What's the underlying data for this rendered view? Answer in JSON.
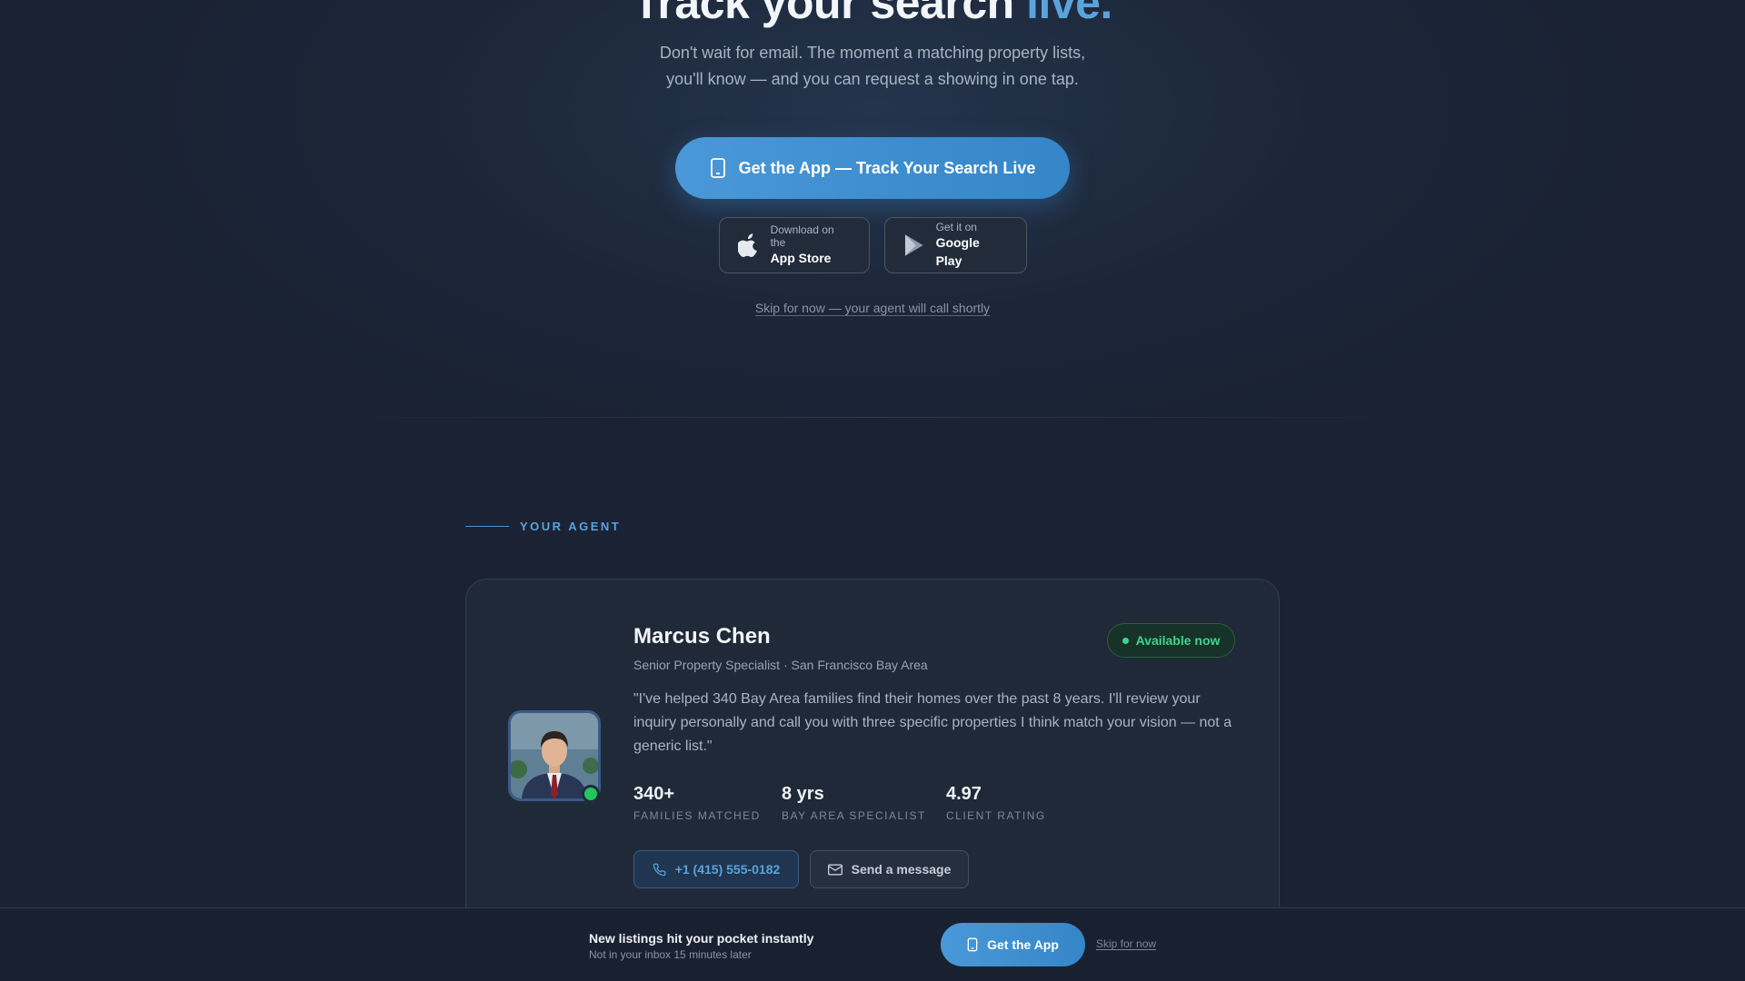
{
  "hero": {
    "title_main": "Track your search ",
    "title_accent": "live.",
    "subtitle_line1": "Don't wait for email. The moment a matching property lists,",
    "subtitle_line2": "you'll know — and you can request a showing in one tap.",
    "primary_cta": "Get the App — Track Your Search Live",
    "app_store_small": "Download on the",
    "app_store_big": "App Store",
    "google_play_small": "Get it on",
    "google_play_big": "Google Play",
    "skip_link": "Skip for now — your agent will call shortly"
  },
  "agent_section": {
    "label": "YOUR AGENT",
    "name": "Marcus Chen",
    "title": "Senior Property Specialist · San Francisco Bay Area",
    "availability": "Available now",
    "quote": "\"I've helped 340 Bay Area families find their homes over the past 8 years. I'll review your inquiry personally and call you with three specific properties I think match your vision — not a generic list.\"",
    "stats": [
      {
        "value": "340+",
        "label": "FAMILIES MATCHED"
      },
      {
        "value": "8 yrs",
        "label": "BAY AREA SPECIALIST"
      },
      {
        "value": "4.97",
        "label": "CLIENT RATING"
      }
    ],
    "phone_button": "+1 (415) 555-0182",
    "message_button": "Send a message"
  },
  "sticky_bar": {
    "headline": "New listings hit your pocket instantly",
    "subtext": "Not in your inbox 15 minutes later",
    "cta": "Get the App",
    "skip": "Skip for now"
  },
  "colors": {
    "accent": "#5ba3dc",
    "cta_blue": "#3f8fd1",
    "available_green": "#3dd68c",
    "background": "#1a2233"
  }
}
